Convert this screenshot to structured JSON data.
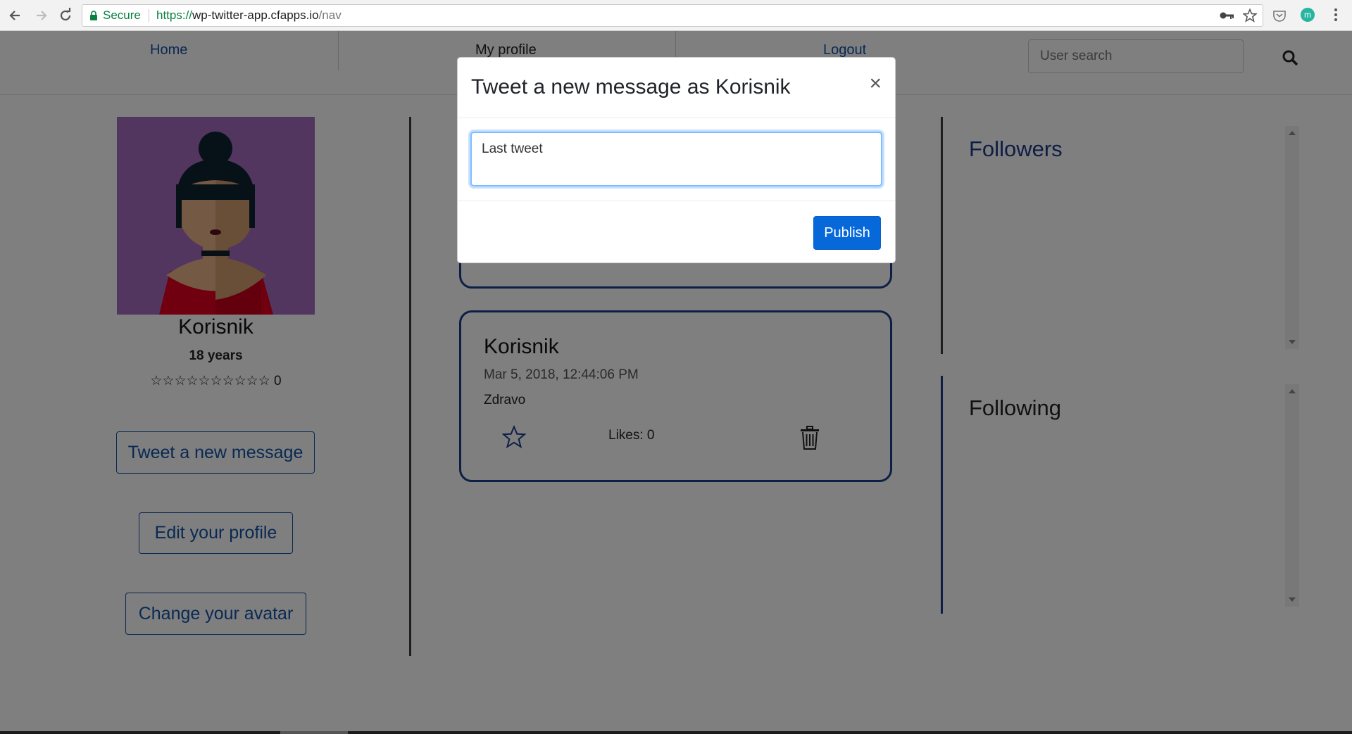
{
  "browser": {
    "secure_label": "Secure",
    "url_protocol": "https://",
    "url_host": "wp-twitter-app.cfapps.io",
    "url_path": "/nav",
    "profile_initial": "m"
  },
  "nav": {
    "home": "Home",
    "my_profile": "My profile",
    "logout": "Logout",
    "search_placeholder": "User search"
  },
  "profile": {
    "name": "Korisnik",
    "age": "18 years",
    "stars": "☆☆☆☆☆☆☆☆☆☆",
    "rating": "0",
    "buttons": {
      "tweet": "Tweet a new message",
      "edit": "Edit your profile",
      "avatar": "Change your avatar"
    }
  },
  "tweets": [
    {
      "author": "Korisnik",
      "date": "Mar 5, 2018, 12:44:06 PM",
      "text": "Zdravo",
      "likes": "Likes: 0"
    }
  ],
  "sidebar": {
    "followers_title": "Followers",
    "following_title": "Following"
  },
  "modal": {
    "title": "Tweet a new message as Korisnik",
    "close": "×",
    "textarea_value": "Last tweet",
    "publish": "Publish"
  },
  "colors": {
    "link_blue": "#1352a6",
    "primary": "#0668d9",
    "followers_accent": "#1e3a8a"
  }
}
